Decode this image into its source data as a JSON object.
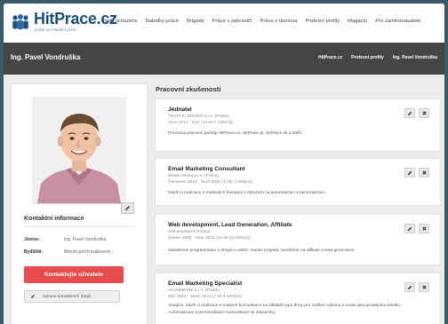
{
  "brand": {
    "name": "HitPrace.cz",
    "tagline": "portál pro hledání práce",
    "accent": "#1f4f7c"
  },
  "nav": {
    "items": [
      "Profil uchazeče",
      "Nabídky práce",
      "Brigády",
      "Práce v zahraničí",
      "Práce z domova",
      "Profesní profily",
      "Magazín",
      "Pro zaměstnavatele"
    ]
  },
  "profile": {
    "name": "Ing. Pavel Vondruška",
    "sub_nav": [
      "HitPrace.cz",
      "Profesní profily",
      "Ing. Pavel Vondruška"
    ]
  },
  "contact": {
    "heading": "Kontaktní informace",
    "name_key": "Jméno:",
    "name_value": "Ing. Pavel Vondruška",
    "residence_key": "Bydliště:",
    "residence_value": "Mimoň pod Kozákovem",
    "contact_button": "Kontaktujte uživatele",
    "contact_button_color": "#e84b4b",
    "edit_button": "Úprava kontaktních údajů"
  },
  "experience": {
    "heading": "Pracovní zkušenosti",
    "jobs": [
      {
        "title": "Jednatel",
        "company": "TRAFFIC DRIVER s.r.o. (Praha)",
        "period": "Únor 2014 - nyní (10 let 7 měsíců)",
        "description": "Provozuji pracovní portály HitPrace.cz, HitPrace.pl, HitPrace.sk a další."
      },
      {
        "title": "Email Marketing Consultant",
        "company": "Wister Media s.r.o. (Praha)",
        "period": "Červenec 2019 - Únor 2021 (1 rok 7 měsíců)",
        "description": "Návrh a realizace e-mailových kampaní s důrazem na automatizaci a personalizaci."
      },
      {
        "title": "Web development, Lead Generation, Affiliate",
        "company": "Self employed (Praha)",
        "period": "Duben 2008 - Únor 2021 (12 let 10 měsíců)",
        "description": "Zakázkové programování e-shopů a webů. Vlastní projekty zaměřené na affiliate a lead generation."
      },
      {
        "title": "Email Marketing Specialist",
        "company": "ACOMWARE s.r.o. (Praha)",
        "period": "Září 2012 - leden 2020 (7 let 4 měsíce)",
        "description": "Analýza, návrh a realizace e-mailové komunikace na základě typu firmy pro zvýšení výkonu e-mailu jako prodejního kanálu. Automatizace a personalizace komunikace se zákazníky."
      }
    ]
  }
}
